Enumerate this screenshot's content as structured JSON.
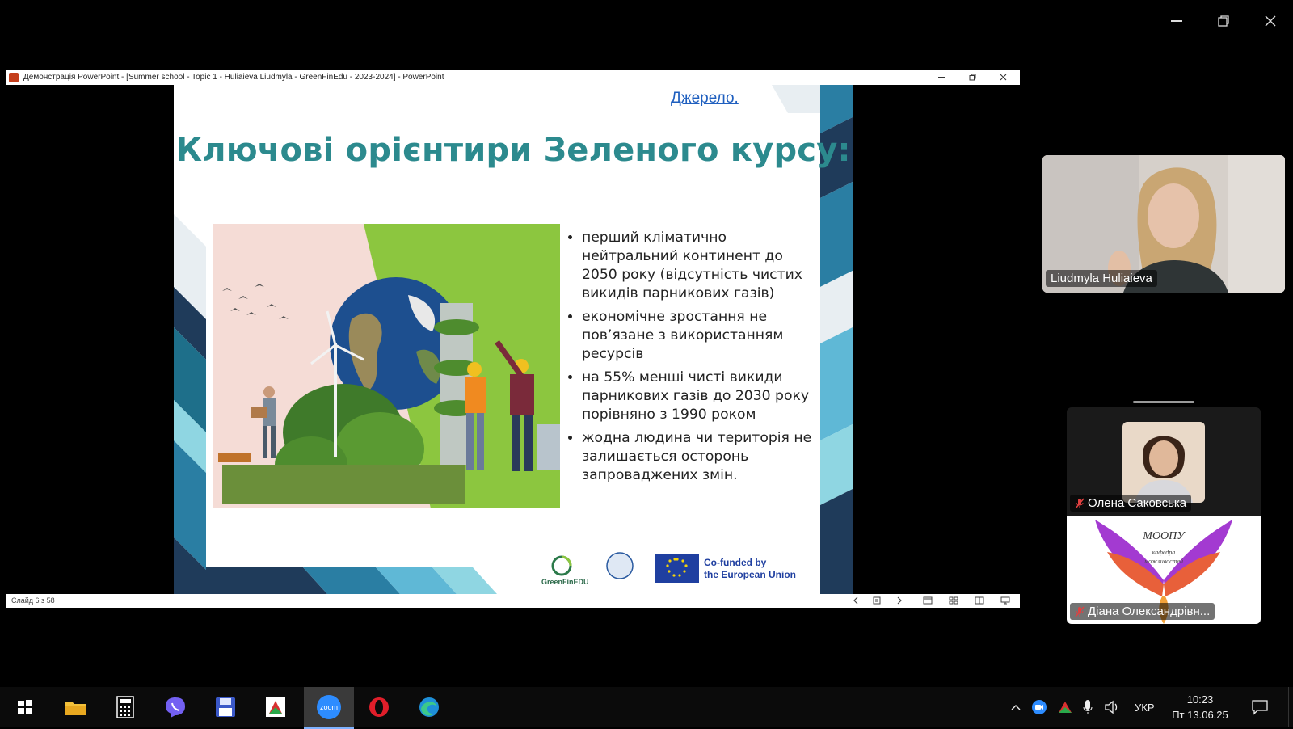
{
  "ppt": {
    "window_title": "Демонстрація PowerPoint - [Summer school - Topic 1 - Huliaieva Liudmyla - GreenFinEdu - 2023-2024] - PowerPoint",
    "status_slide": "Слайд 6 з 58"
  },
  "slide": {
    "source_link": "Джерело.",
    "title": "Ключові орієнтири Зеленого курсу:",
    "bullets": [
      "перший кліматично нейтральний континент до 2050 року (відсутність чистих викидів парникових газів)",
      "економічне зростання не пов’язане з використанням ресурсів",
      "на 55% менші чисті викиди парникових газів до 2030 року порівняно з 1990 роком",
      "жодна людина чи територія не залишається осторонь запроваджених змін."
    ],
    "logos": {
      "greenfin": "GreenFinEDU",
      "eu_line1": "Co-funded by",
      "eu_line2": "the European Union"
    }
  },
  "participants": {
    "speaker": "Liudmyla Huliaieva",
    "p2": "Олена Саковська",
    "p3": "Діана Олександрівн...",
    "p3_logo_title": "МООПУ",
    "p3_logo_sub1": "кафедра",
    "p3_logo_sub2": "можливостей"
  },
  "taskbar": {
    "zoom_label": "zoom",
    "lang": "УКР",
    "time": "10:23",
    "date": "Пт 13.06.25"
  },
  "colors": {
    "slide_title": "#2c8a8e",
    "link": "#1f5fbf",
    "taskbar_active": "#2d8cff"
  }
}
